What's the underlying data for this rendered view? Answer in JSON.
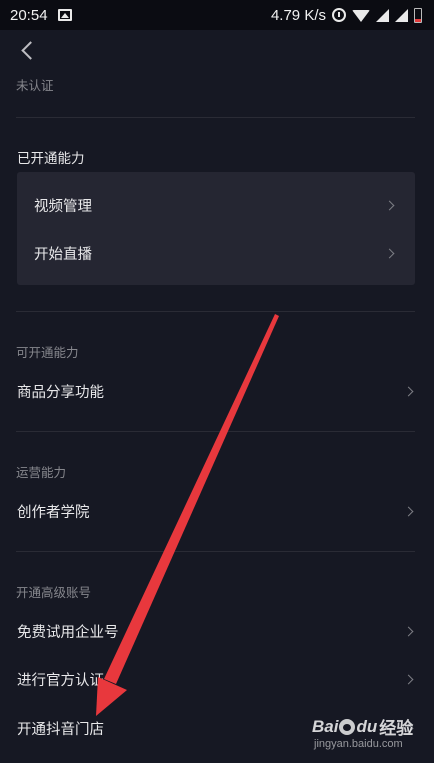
{
  "status_bar": {
    "time": "20:54",
    "net_speed": "4.79 K/s",
    "icons": [
      "image-icon",
      "alarm-icon",
      "wifi-icon",
      "signal-icon",
      "battery-icon"
    ]
  },
  "header": {
    "back_icon": "chevron-left-icon"
  },
  "verification_status": "未认证",
  "enabled_section": {
    "title": "已开通能力",
    "items": [
      {
        "label": "视频管理"
      },
      {
        "label": "开始直播"
      }
    ]
  },
  "available_section": {
    "title": "可开通能力",
    "items": [
      {
        "label": "商品分享功能"
      }
    ]
  },
  "operations_section": {
    "title": "运营能力",
    "items": [
      {
        "label": "创作者学院"
      }
    ]
  },
  "advanced_section": {
    "title": "开通高级账号",
    "items": [
      {
        "label": "免费试用企业号"
      },
      {
        "label": "进行官方认证"
      },
      {
        "label": "开通抖音门店"
      }
    ]
  },
  "annotation": {
    "color": "#e8383d",
    "icon": "red-arrow-annotation"
  },
  "watermark": {
    "brand": "Bai",
    "brand_suffix": "du",
    "product": "经验",
    "url": "jingyan.baidu.com"
  }
}
